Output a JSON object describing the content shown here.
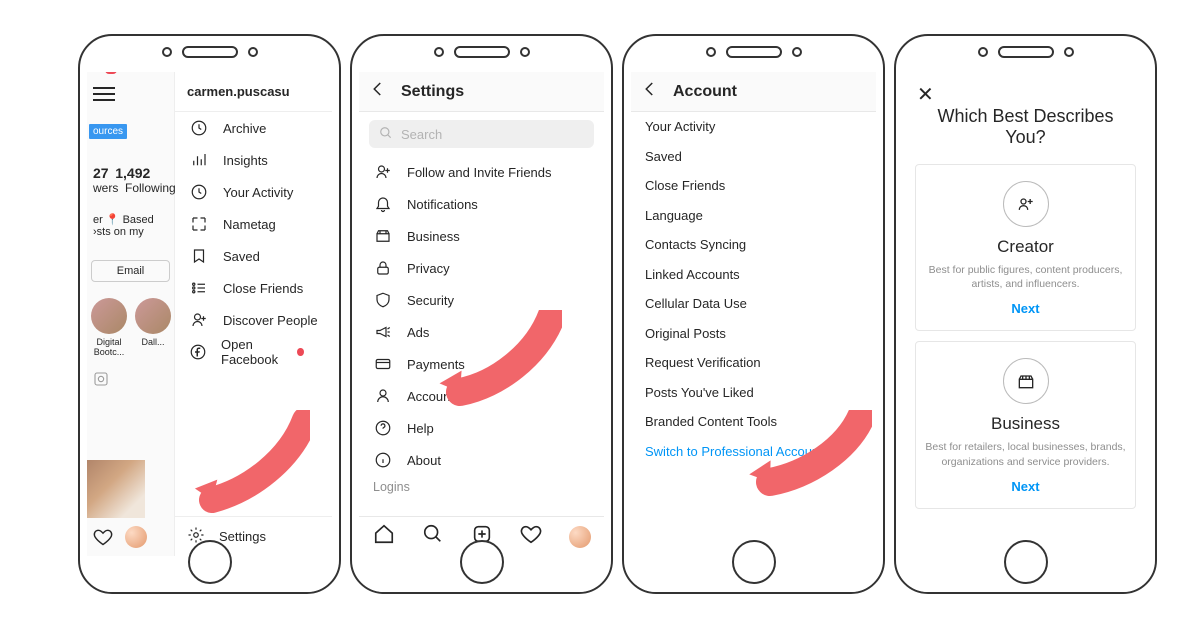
{
  "p1": {
    "username": "carmen.puscasu",
    "tabLabel": "ources",
    "followers": {
      "n": "27",
      "l": "wers"
    },
    "following": {
      "n": "1,492",
      "l": "Following"
    },
    "bioSnippet": "er 📍 Based\n›sts on my",
    "emailBtn": "Email",
    "storyLabels": [
      "Digital Bootc...",
      "Dall..."
    ],
    "menu": [
      "Archive",
      "Insights",
      "Your Activity",
      "Nametag",
      "Saved",
      "Close Friends",
      "Discover People",
      "Open Facebook"
    ],
    "settings": "Settings"
  },
  "p2": {
    "title": "Settings",
    "searchPlaceholder": "Search",
    "items": [
      "Follow and Invite Friends",
      "Notifications",
      "Business",
      "Privacy",
      "Security",
      "Ads",
      "Payments",
      "Account",
      "Help",
      "About"
    ],
    "loginsHeader": "Logins"
  },
  "p3": {
    "title": "Account",
    "items": [
      "Your Activity",
      "Saved",
      "Close Friends",
      "Language",
      "Contacts Syncing",
      "Linked Accounts",
      "Cellular Data Use",
      "Original Posts",
      "Request Verification",
      "Posts You've Liked",
      "Branded Content Tools"
    ],
    "switch": "Switch to Professional Account"
  },
  "p4": {
    "question": "Which Best Describes You?",
    "creator": {
      "title": "Creator",
      "desc": "Best for public figures, content producers, artists, and influencers.",
      "next": "Next"
    },
    "business": {
      "title": "Business",
      "desc": "Best for retailers, local businesses, brands, organizations and service providers.",
      "next": "Next"
    }
  }
}
